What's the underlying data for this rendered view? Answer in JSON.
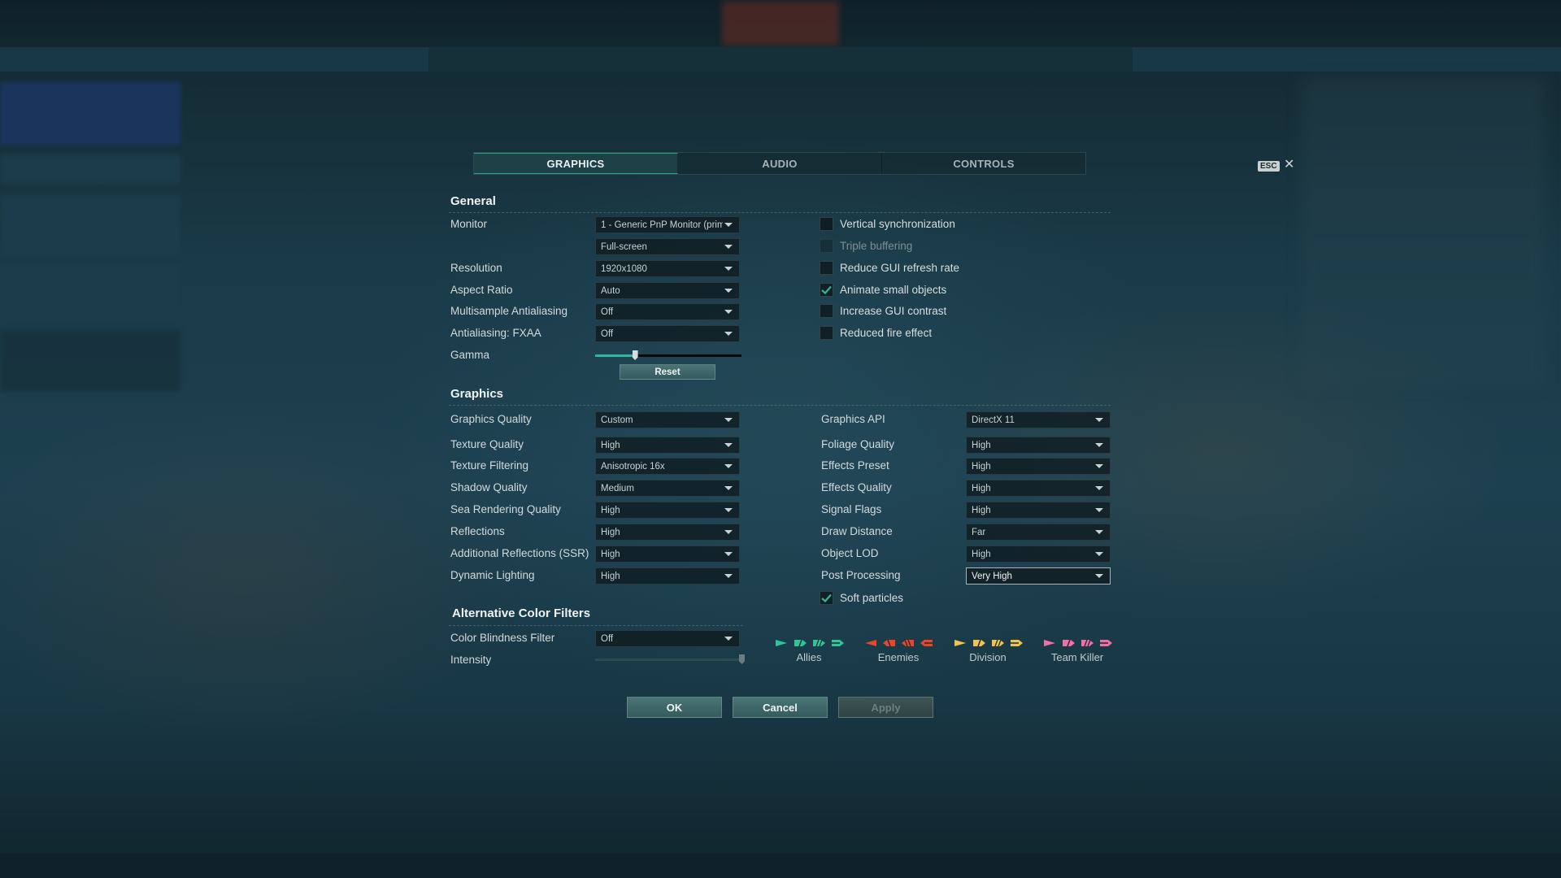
{
  "dialog": {
    "tabs": [
      {
        "label": "GRAPHICS",
        "active": true
      },
      {
        "label": "AUDIO",
        "active": false
      },
      {
        "label": "CONTROLS",
        "active": false
      }
    ],
    "esc_label": "ESC",
    "close_glyph": "✕"
  },
  "general": {
    "title": "General",
    "monitor": {
      "label": "Monitor",
      "value": "1 - Generic PnP Monitor (prim"
    },
    "window_mode": {
      "value": "Full-screen"
    },
    "resolution": {
      "label": "Resolution",
      "value": "1920x1080"
    },
    "aspect_ratio": {
      "label": "Aspect Ratio",
      "value": "Auto"
    },
    "msaa": {
      "label": "Multisample Antialiasing",
      "value": "Off"
    },
    "fxaa": {
      "label": "Antialiasing: FXAA",
      "value": "Off"
    },
    "gamma": {
      "label": "Gamma",
      "value_percent": 27
    },
    "reset_label": "Reset",
    "checkboxes": [
      {
        "label": "Vertical synchronization",
        "checked": false,
        "disabled": false
      },
      {
        "label": "Triple buffering",
        "checked": false,
        "disabled": true
      },
      {
        "label": "Reduce GUI refresh rate",
        "checked": false,
        "disabled": false
      },
      {
        "label": "Animate small objects",
        "checked": true,
        "disabled": false
      },
      {
        "label": "Increase GUI contrast",
        "checked": false,
        "disabled": false
      },
      {
        "label": "Reduced fire effect",
        "checked": false,
        "disabled": false
      }
    ]
  },
  "graphics": {
    "title": "Graphics",
    "left": [
      {
        "label": "Graphics Quality",
        "value": "Custom"
      },
      {
        "label": "Texture Quality",
        "value": "High"
      },
      {
        "label": "Texture Filtering",
        "value": "Anisotropic 16x"
      },
      {
        "label": "Shadow Quality",
        "value": "Medium"
      },
      {
        "label": "Sea Rendering Quality",
        "value": "High"
      },
      {
        "label": "Reflections",
        "value": "High"
      },
      {
        "label": "Additional Reflections (SSR)",
        "value": "High"
      },
      {
        "label": "Dynamic Lighting",
        "value": "High"
      }
    ],
    "right": [
      {
        "label": "Graphics API",
        "value": "DirectX 11"
      },
      {
        "label": "Foliage Quality",
        "value": "High"
      },
      {
        "label": "Effects Preset",
        "value": "High"
      },
      {
        "label": "Effects Quality",
        "value": "High"
      },
      {
        "label": "Signal Flags",
        "value": "High"
      },
      {
        "label": "Draw Distance",
        "value": "Far"
      },
      {
        "label": "Object LOD",
        "value": "High"
      },
      {
        "label": "Post Processing",
        "value": "Very High"
      }
    ],
    "soft_particles": {
      "label": "Soft particles",
      "checked": true
    }
  },
  "color_filters": {
    "title": "Alternative Color Filters",
    "filter": {
      "label": "Color Blindness Filter",
      "value": "Off"
    },
    "intensity": {
      "label": "Intensity",
      "value_percent": 100
    },
    "legend": [
      {
        "label": "Allies",
        "color": "#2fc49a"
      },
      {
        "label": "Enemies",
        "color": "#e8452a"
      },
      {
        "label": "Division",
        "color": "#f2c24f"
      },
      {
        "label": "Team Killer",
        "color": "#ef6fa8"
      }
    ]
  },
  "footer": {
    "ok_label": "OK",
    "cancel_label": "Cancel",
    "apply_label": "Apply"
  },
  "colors": {
    "accent": "#2fb79b",
    "check": "#2fb79b"
  }
}
